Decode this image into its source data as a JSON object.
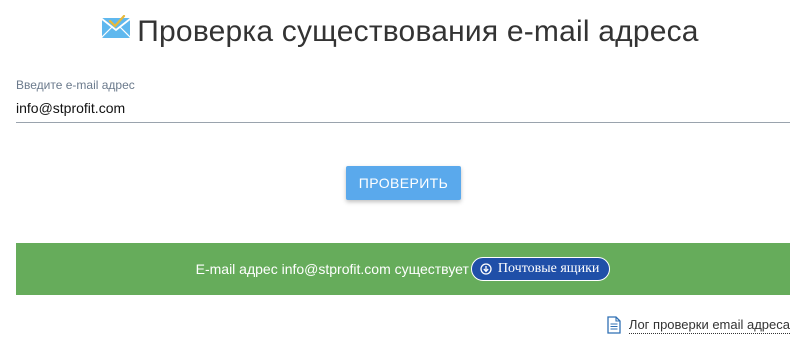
{
  "header": {
    "icon": "envelope-icon",
    "title": "Проверка существования e-mail адреса"
  },
  "form": {
    "email_label": "Введите e-mail адрес",
    "email_value": "info@stprofit.com",
    "check_button": "ПРОВЕРИТЬ"
  },
  "result": {
    "text": "E-mail адрес info@stprofit.com существует",
    "mailbox_button": "Почтовые ящики",
    "mailbox_icon": "circle-arrow-down-icon",
    "status_color": "#66ac5b"
  },
  "log": {
    "icon": "document-icon",
    "label": "Лог проверки email адреса"
  },
  "colors": {
    "button_primary": "#5aa9ec",
    "success_bar": "#66ac5b",
    "mailbox_button": "#1f4fa8"
  }
}
